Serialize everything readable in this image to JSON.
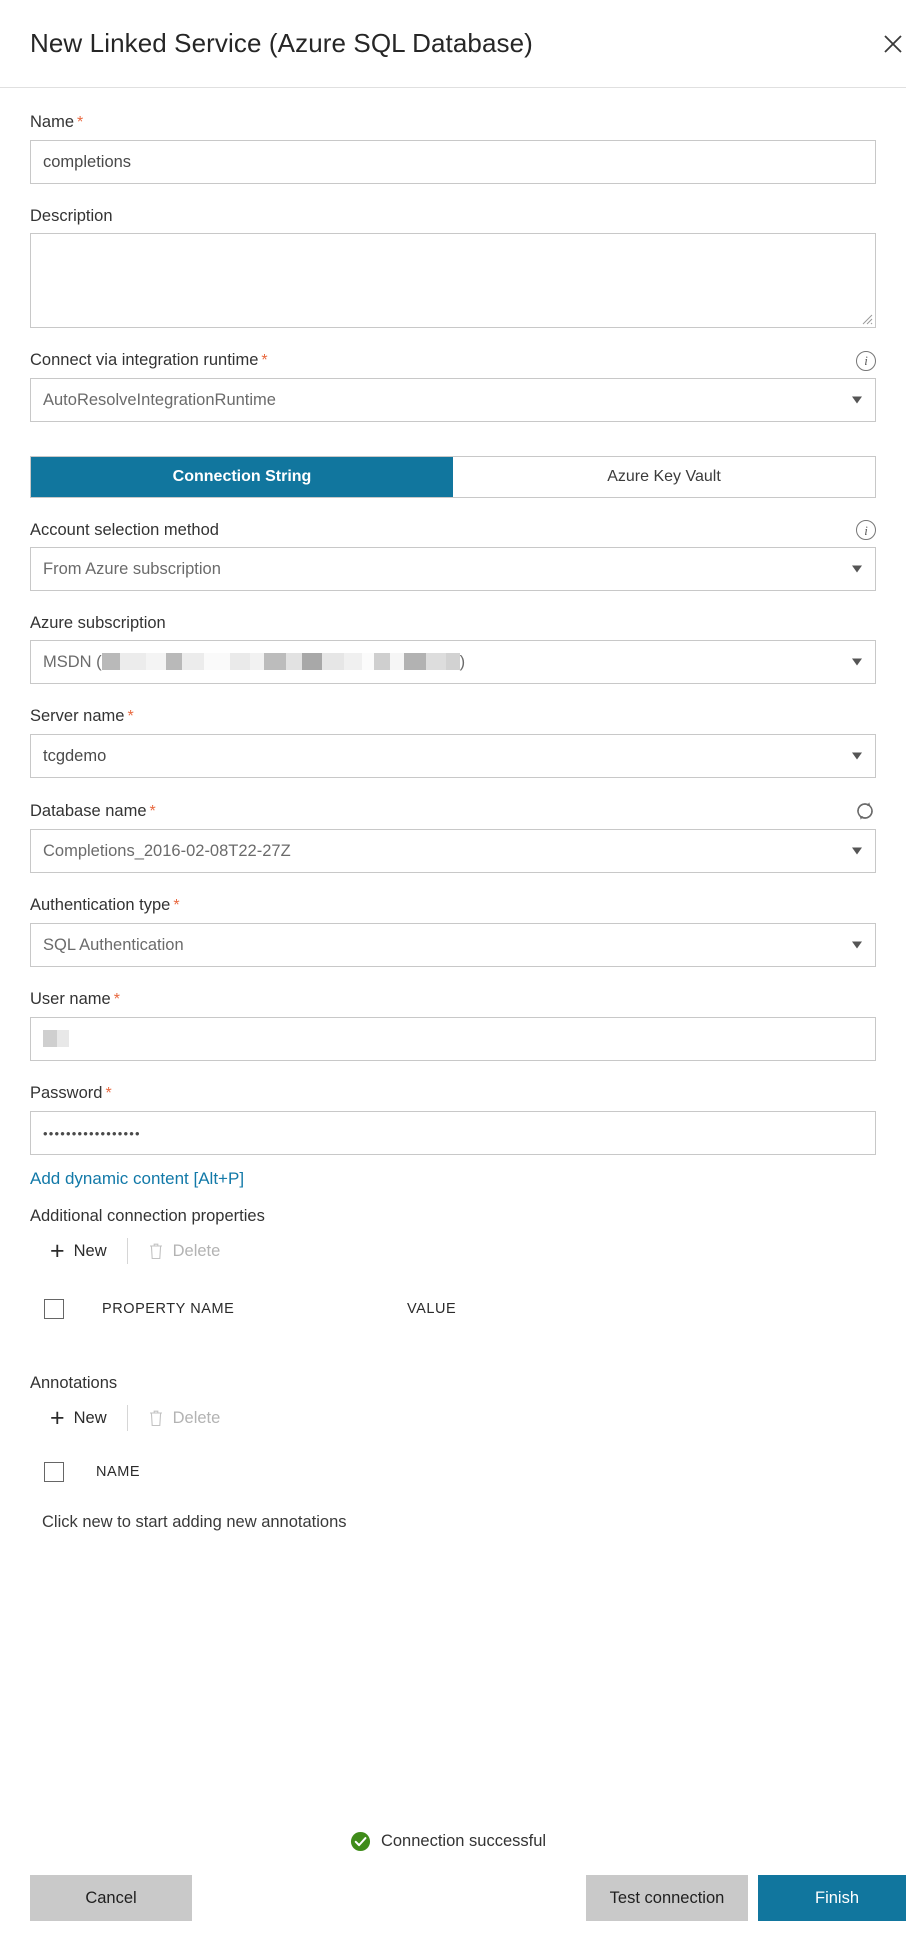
{
  "header": {
    "title": "New Linked Service (Azure SQL Database)",
    "close_icon": "close-icon"
  },
  "form": {
    "name": {
      "label": "Name",
      "required": "*",
      "value": "completions"
    },
    "description": {
      "label": "Description",
      "value": "",
      "placeholder": ""
    },
    "integration_runtime": {
      "label": "Connect via integration runtime",
      "required": "*",
      "value": "AutoResolveIntegrationRuntime",
      "info_icon": "info-icon"
    },
    "tabs": [
      {
        "label": "Connection String",
        "active": true
      },
      {
        "label": "Azure Key Vault",
        "active": false
      }
    ],
    "account_selection_method": {
      "label": "Account selection method",
      "value": "From Azure subscription",
      "info_icon": "info-icon"
    },
    "azure_subscription": {
      "label": "Azure subscription",
      "value_prefix": "MSDN (",
      "value_suffix": ")",
      "redacted": true
    },
    "server_name": {
      "label": "Server name",
      "required": "*",
      "value": "tcgdemo"
    },
    "database_name": {
      "label": "Database name",
      "required": "*",
      "value": "Completions_2016-02-08T22-27Z",
      "refresh_icon": "refresh-icon"
    },
    "authentication_type": {
      "label": "Authentication type",
      "required": "*",
      "value": "SQL Authentication"
    },
    "user_name": {
      "label": "User name",
      "required": "*",
      "value": "",
      "redacted": true
    },
    "password": {
      "label": "Password",
      "required": "*",
      "value": "•••••••••••••••••"
    },
    "add_dynamic_content": {
      "label": "Add dynamic content [Alt+P]"
    }
  },
  "additional_connection_properties": {
    "title": "Additional connection properties",
    "new_label": "New",
    "delete_label": "Delete",
    "columns": [
      "PROPERTY NAME",
      "VALUE"
    ],
    "rows": []
  },
  "annotations": {
    "title": "Annotations",
    "new_label": "New",
    "delete_label": "Delete",
    "columns": [
      "NAME"
    ],
    "rows": [],
    "empty_message": "Click new to start adding new annotations"
  },
  "status": {
    "text": "Connection successful",
    "icon": "check-circle-icon",
    "color": "#3f8c1a"
  },
  "footer": {
    "cancel_label": "Cancel",
    "test_connection_label": "Test connection",
    "finish_label": "Finish"
  },
  "theme": {
    "accent": "#11769e",
    "required_star": "#e8683f",
    "link": "#1279a8",
    "success": "#3f8c1a"
  }
}
